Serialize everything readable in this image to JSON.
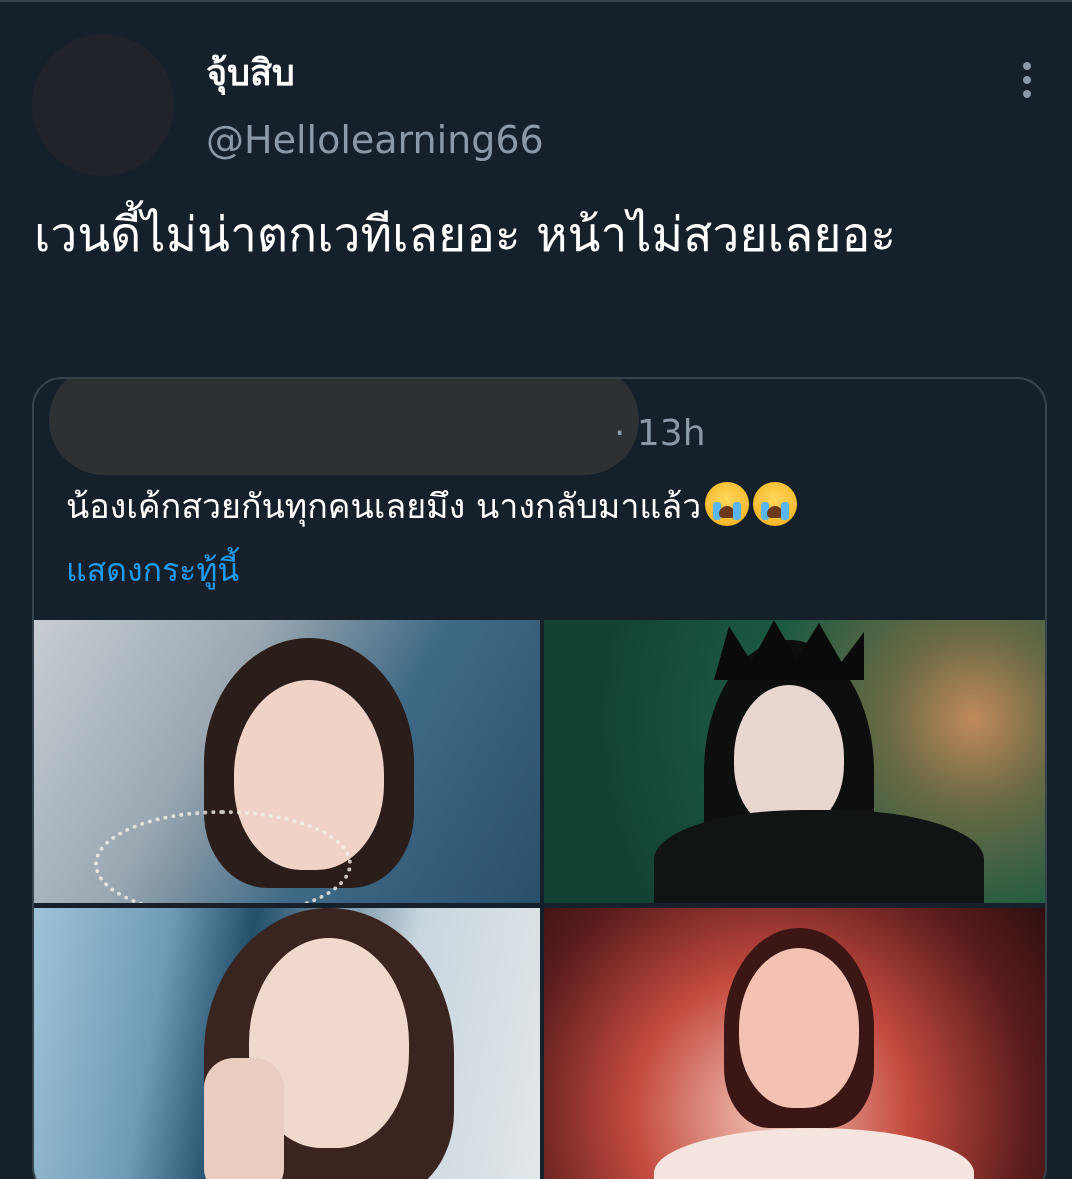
{
  "tweet": {
    "display_name": "จุ้บสิบ",
    "handle": "@Hellolearning66",
    "text": "เวนดี้ไม่น่าตกเวทีเลยอะ หน้าไม่สวยเลยอะ"
  },
  "quote": {
    "meta": "· 13h",
    "text": "น้องเค้กสวยกันทุกคนเลยมึง นางกลับมาแล้ว",
    "emoji_names": [
      "loudly-crying-face",
      "loudly-crying-face"
    ],
    "show_thread_label": "แสดงกระทู้นี้"
  },
  "colors": {
    "background": "#15202b",
    "secondary_text": "#8b98a5",
    "link": "#1d9bf0",
    "border": "#38444d"
  }
}
